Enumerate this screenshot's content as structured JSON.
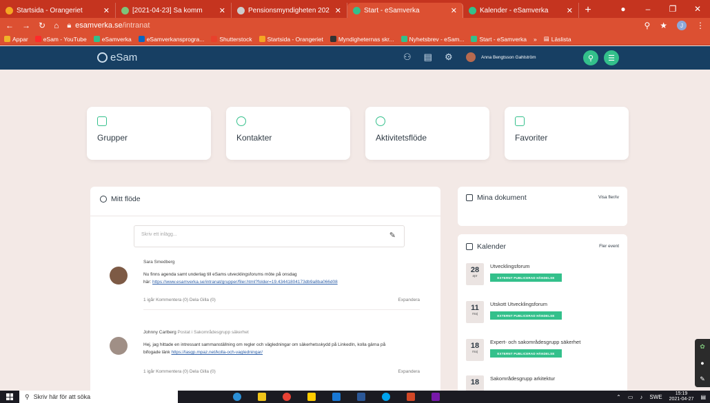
{
  "browser": {
    "tabs": [
      {
        "label": "Startsida - Orangeriet",
        "color": "#f5a623",
        "active": false
      },
      {
        "label": "[2021-04-23] Sa komm",
        "color": "#7ec37a",
        "active": false
      },
      {
        "label": "Pensionsmyndigheten 202",
        "color": "#cccccc",
        "active": false
      },
      {
        "label": "Start - eSamverka",
        "color": "#33c08b",
        "active": true
      },
      {
        "label": "Kalender - eSamverka",
        "color": "#33c08b",
        "active": false
      }
    ],
    "new_tab": "+",
    "address": {
      "host": "esamverka.se",
      "path": "/intranat"
    },
    "profile_initial": "J",
    "bookmarks": [
      {
        "label": "Appar",
        "color": "#f0b429"
      },
      {
        "label": "eSam - YouTube",
        "color": "#ff2a2a"
      },
      {
        "label": "eSamverka",
        "color": "#33c08b"
      },
      {
        "label": "eSamverkansprogra...",
        "color": "#0a66c2"
      },
      {
        "label": "Shutterstock",
        "color": "#e8412c"
      },
      {
        "label": "Startsida - Orangeriet",
        "color": "#f5a623"
      },
      {
        "label": "Myndigheternas skr...",
        "color": "#333333"
      },
      {
        "label": "Nyhetsbrev - eSam...",
        "color": "#33c08b"
      },
      {
        "label": "Start - eSamverka",
        "color": "#33c08b"
      }
    ],
    "bookmarks_more": "»",
    "reading_list": "Läslista"
  },
  "app": {
    "logo": "eSam",
    "user_name": "Anna Bengtsson Gahlström"
  },
  "tiles": [
    {
      "label": "Grupper"
    },
    {
      "label": "Kontakter"
    },
    {
      "label": "Aktivitetsflöde"
    },
    {
      "label": "Favoriter"
    }
  ],
  "feed": {
    "title": "Mitt flöde",
    "post_placeholder": "Skriv ett inlägg...",
    "posts": [
      {
        "author": "Sara Smedberg",
        "role": "",
        "text": "Nu finns agenda samt underlag till eSams utvecklingsforums möte på onsdag",
        "link_prefix": "här:",
        "link": "https://www.esamverka.se/intranat/grupper/filer.html?folder=19.43441804173db9a8ba066d08",
        "meta": "1 igår  Kommentera (0)  Dela  Gilla (0)",
        "expand": "Expandera"
      },
      {
        "author": "Johnny Carlberg",
        "role": "Postat i Sakområdesgrupp säkerhet",
        "text": "Hej, jag hittade en intressant sammanställning om regler och vägledningar om säkerhetsskydd på LinkedIn, kolla gärna på",
        "link_prefix": "bifogade länk",
        "link": "https://lasgp.mpaz.net/kolla-och-vagledningar/",
        "meta": "1 igår  Kommentera (0)  Dela  Gilla (0)",
        "expand": "Expandera"
      }
    ]
  },
  "documents": {
    "title": "Mina dokument",
    "link": "Visa fler/iv"
  },
  "calendar": {
    "title": "Kalender",
    "link": "Fler event",
    "events": [
      {
        "day": "28",
        "month": "apr",
        "title": "Utvecklingsforum",
        "tag": "EXTERNT PUBLICERAD HÄNDELSE"
      },
      {
        "day": "11",
        "month": "maj",
        "title": "Utskott Utvecklingsforum",
        "tag": "EXTERNT PUBLICERAD HÄNDELSE"
      },
      {
        "day": "18",
        "month": "maj",
        "title": "Expert- och sakområdesgrupp säkerhet",
        "tag": "EXTERNT PUBLICERAD HÄNDELSE"
      },
      {
        "day": "18",
        "month": "",
        "title": "Sakområdesgrupp arkitektur",
        "tag": ""
      }
    ]
  },
  "taskbar": {
    "search_placeholder": "Skriv här för att söka",
    "language": "SWE",
    "time": "15:19",
    "date": "2021-04-27",
    "apps": [
      {
        "name": "edge",
        "color": "#2b8fd6"
      },
      {
        "name": "explorer",
        "color": "#f0c419"
      },
      {
        "name": "chrome",
        "color": "#e94235"
      },
      {
        "name": "sticky",
        "color": "#ffcc00"
      },
      {
        "name": "outlook",
        "color": "#1978d4"
      },
      {
        "name": "word",
        "color": "#2b5797"
      },
      {
        "name": "skype",
        "color": "#00a4ef"
      },
      {
        "name": "powerpoint",
        "color": "#d24726"
      },
      {
        "name": "onenote",
        "color": "#7719aa"
      }
    ]
  }
}
